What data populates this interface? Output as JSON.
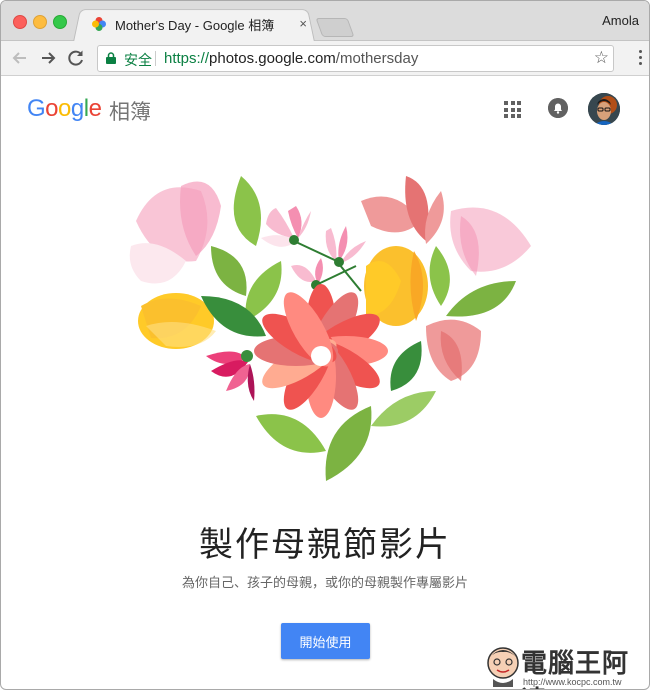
{
  "browser": {
    "tab_title": "Mother's Day - Google 相簿",
    "tab_close": "×",
    "profile_name": "Amola",
    "security_label": "安全",
    "url_scheme": "https://",
    "url_host": "photos.google.com",
    "url_path": "/mothersday"
  },
  "app": {
    "logo_letters": [
      "G",
      "o",
      "o",
      "g",
      "l",
      "e"
    ],
    "product_name": "相簿"
  },
  "main": {
    "heading": "製作母親節影片",
    "subtitle": "為你自己、孩子的母親，或你的母親製作專屬影片",
    "cta_label": "開始使用"
  },
  "watermark": {
    "text": "電腦王阿達",
    "url": "http://www.kocpc.com.tw"
  },
  "colors": {
    "accent_blue": "#4285f4",
    "leaf_green": "#7cb342",
    "petal_pink": "#f48fb1",
    "petal_yellow": "#fbc02d",
    "petal_red": "#ef5350"
  }
}
